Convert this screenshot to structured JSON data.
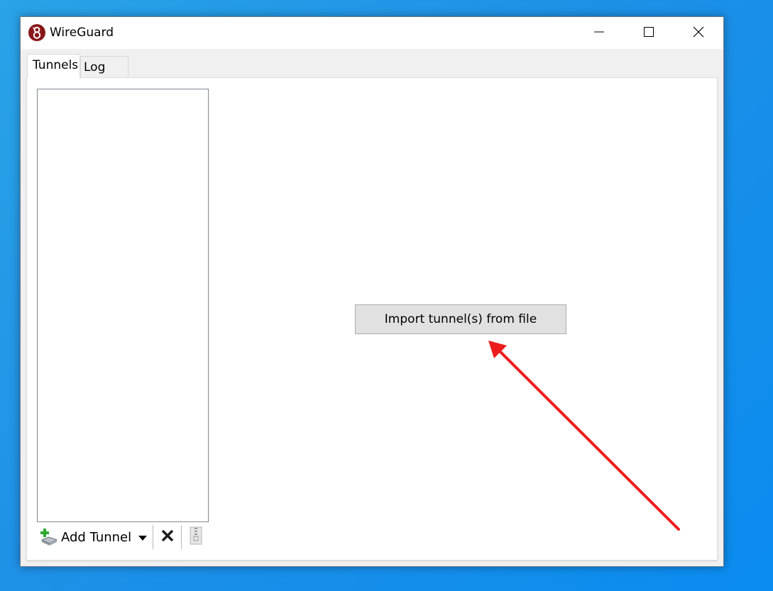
{
  "window": {
    "title": "WireGuard",
    "app_icon": "wireguard-logo-icon",
    "controls": {
      "minimize_icon": "minimize-icon",
      "maximize_icon": "maximize-icon",
      "close_icon": "close-icon"
    }
  },
  "tabs": [
    {
      "label": "Tunnels",
      "active": true
    },
    {
      "label": "Log",
      "active": false
    }
  ],
  "tunnels": {
    "items": []
  },
  "toolbar": {
    "add_tunnel_label": "Add Tunnel",
    "add_tunnel_icon": "add-tunnel-icon",
    "dropdown_icon": "dropdown-arrow-icon",
    "delete_icon": "delete-x-icon",
    "export_icon": "export-zip-icon"
  },
  "main": {
    "import_button_label": "Import tunnel(s) from file"
  },
  "annotation": {
    "arrow_color": "#ee1c1c"
  },
  "colors": {
    "desktop": "#1e90e6",
    "logo_red": "#88171a"
  }
}
